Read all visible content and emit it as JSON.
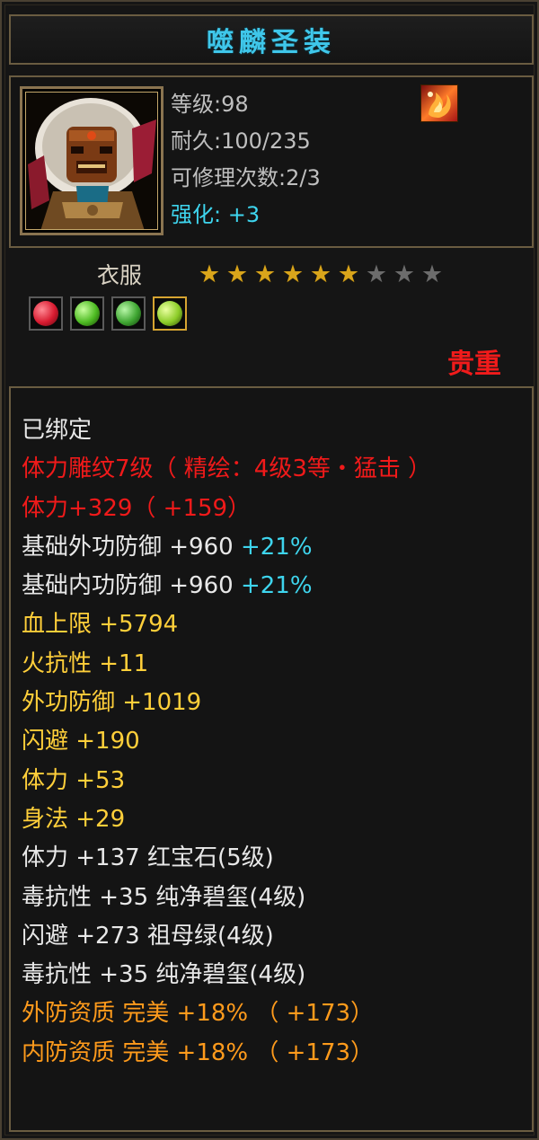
{
  "title": "噬麟圣装",
  "item": {
    "portrait_icon": "warrior-mask-portrait",
    "level": "等级:98",
    "durability": "耐久:100/235",
    "repair": "可修理次数:2/3",
    "enhance_label": "强化:",
    "enhance_value": "+3",
    "skill_icon": "flame-emblem-icon"
  },
  "type_label": "衣服",
  "stars": {
    "filled": 6,
    "total": 9
  },
  "gems": [
    {
      "name": "ruby-gem",
      "color": "#d81b30"
    },
    {
      "name": "green-gem",
      "color": "#4dbb22"
    },
    {
      "name": "jade-gem",
      "color": "#3fa632"
    },
    {
      "name": "emerald-gem",
      "color": "#8ccc28"
    }
  ],
  "rarity": "贵重",
  "attributes": [
    {
      "text": "已绑定",
      "color": "white"
    },
    {
      "text": "体力雕纹7级（ 精绘：4级3等・猛击 ）",
      "color": "red"
    },
    {
      "text": "体力+329（ +159）",
      "color": "red"
    },
    {
      "text": "基础外功防御  +960",
      "suffix": " +21%",
      "color": "white"
    },
    {
      "text": "基础内功防御  +960",
      "suffix": " +21%",
      "color": "white"
    },
    {
      "text": "血上限  +5794",
      "color": "yellow"
    },
    {
      "text": "火抗性  +11",
      "color": "yellow"
    },
    {
      "text": "外功防御  +1019",
      "color": "yellow"
    },
    {
      "text": "闪避  +190",
      "color": "yellow"
    },
    {
      "text": "体力  +53",
      "color": "yellow"
    },
    {
      "text": "身法  +29",
      "color": "yellow"
    },
    {
      "text": "体力  +137  红宝石(5级)",
      "color": "white"
    },
    {
      "text": "毒抗性  +35  纯净碧玺(4级)",
      "color": "white"
    },
    {
      "text": "闪避  +273  祖母绿(4级)",
      "color": "white"
    },
    {
      "text": "毒抗性  +35  纯净碧玺(4级)",
      "color": "white"
    },
    {
      "text": "外防资质   完美  +18% （ +173）",
      "color": "orange"
    },
    {
      "text": "内防资质   完美  +18% （ +173）",
      "color": "orange"
    }
  ]
}
